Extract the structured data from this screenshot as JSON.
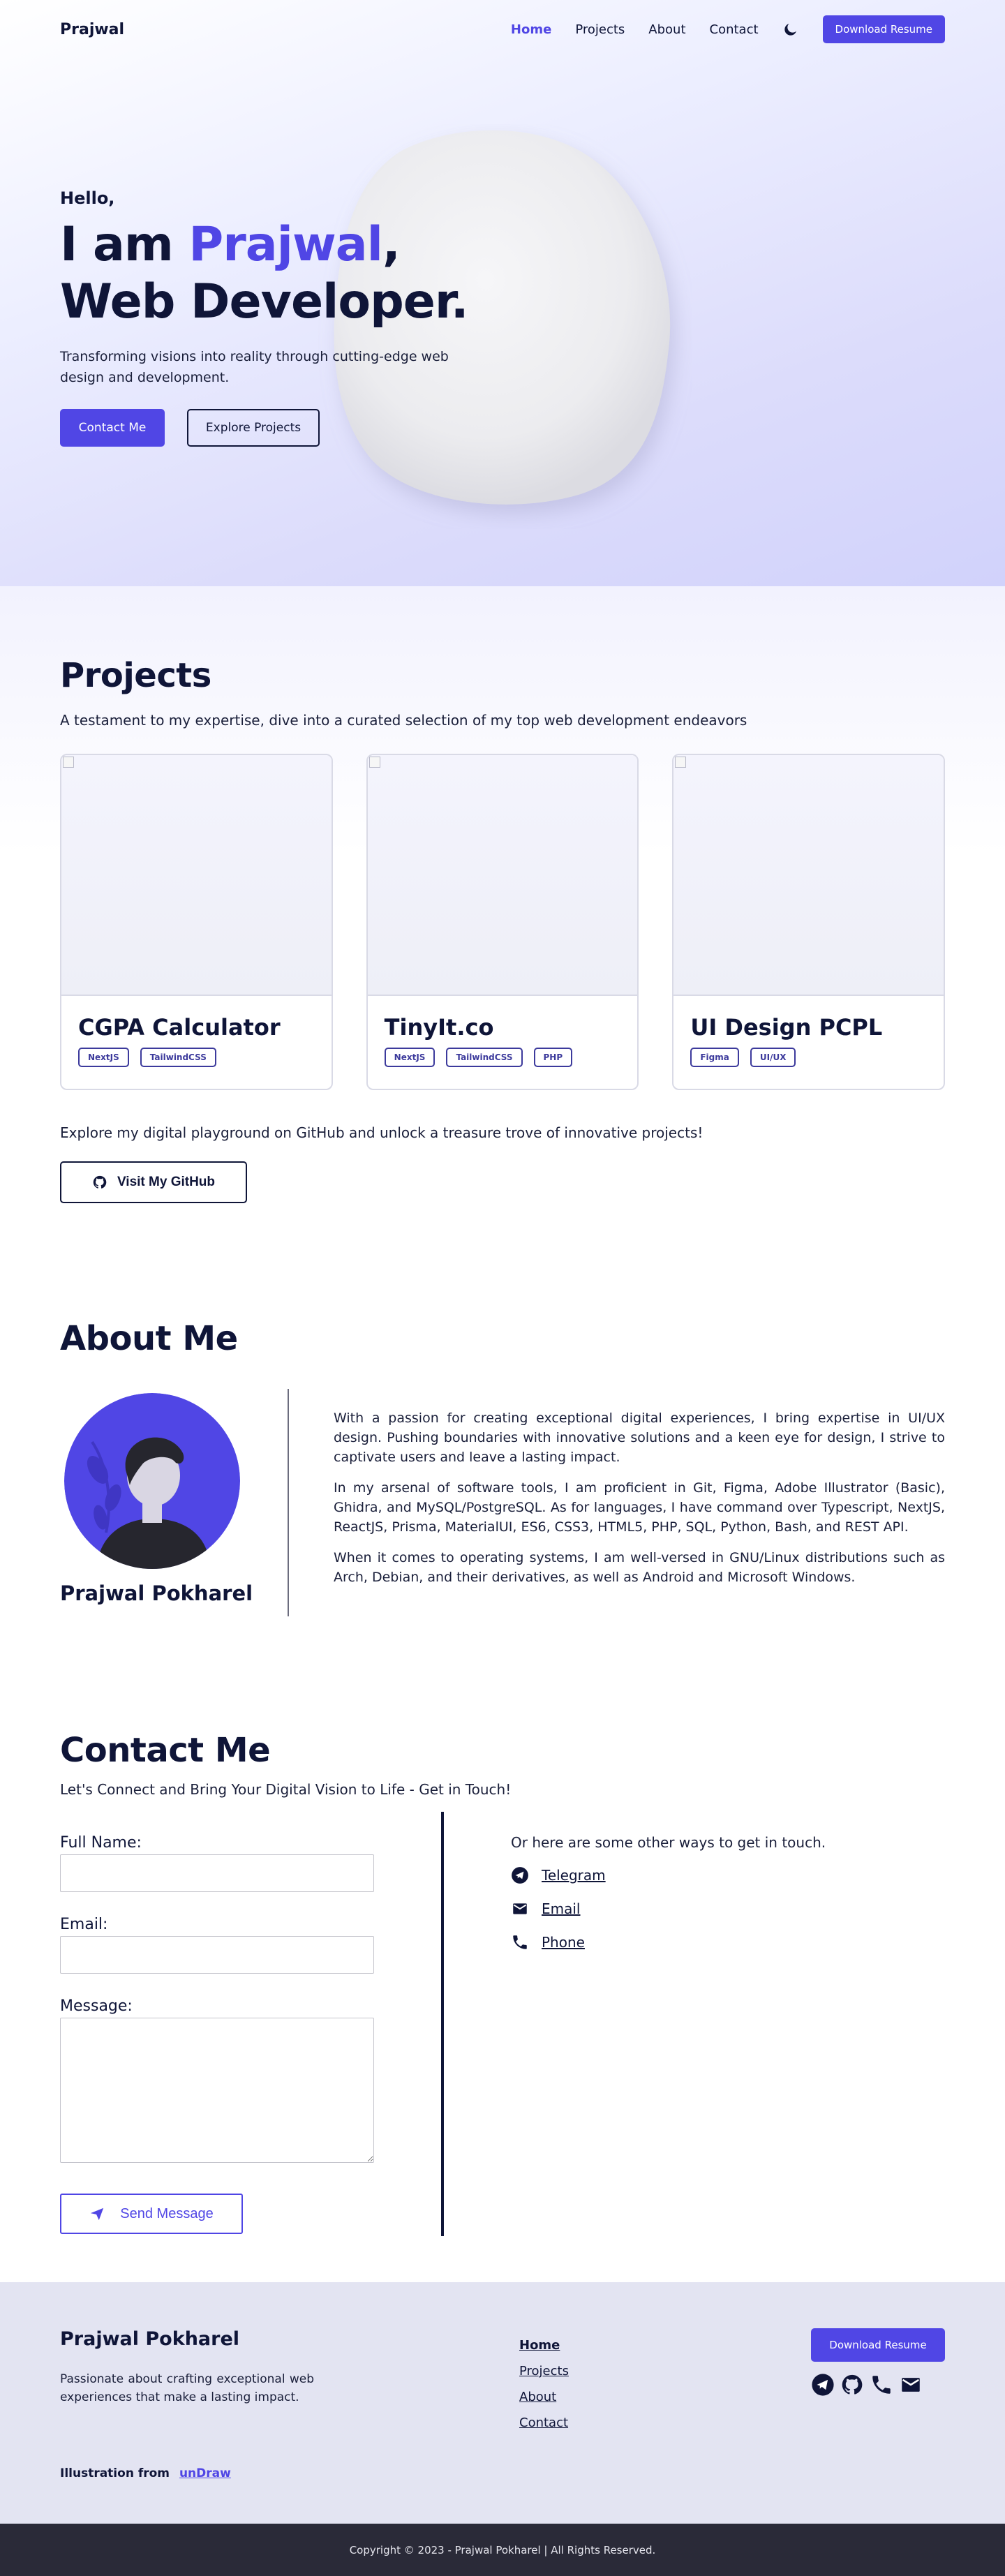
{
  "nav": {
    "brand": "Prajwal",
    "links": [
      "Home",
      "Projects",
      "About",
      "Contact"
    ],
    "resume_label": "Download Resume"
  },
  "hero": {
    "greeting": "Hello,",
    "title_prefix": "I am ",
    "title_name": "Prajwal",
    "title_comma": ",",
    "title_line2": "Web Developer.",
    "description": "Transforming visions into reality through cutting-edge web design and development.",
    "contact_label": "Contact Me",
    "explore_label": "Explore Projects"
  },
  "projects": {
    "title": "Projects",
    "subtitle": "A testament to my expertise, dive into a curated selection of my top web development endeavors",
    "cards": [
      {
        "title": "CGPA Calculator",
        "tags": [
          "NextJS",
          "TailwindCSS"
        ]
      },
      {
        "title": "TinyIt.co",
        "tags": [
          "NextJS",
          "TailwindCSS",
          "PHP"
        ]
      },
      {
        "title": "UI Design PCPL",
        "tags": [
          "Figma",
          "UI/UX"
        ]
      }
    ],
    "github_text": "Explore my digital playground on GitHub and unlock a treasure trove of innovative projects!",
    "github_label": "Visit My GitHub"
  },
  "about": {
    "title": "About Me",
    "name": "Prajwal Pokharel",
    "paragraphs": [
      "With a passion for creating exceptional digital experiences, I bring expertise in UI/UX design. Pushing boundaries with innovative solutions and a keen eye for design, I strive to captivate users and leave a lasting impact.",
      "In my arsenal of software tools, I am proficient in Git, Figma, Adobe Illustrator (Basic), Ghidra, and MySQL/PostgreSQL. As for languages, I have command over Typescript, NextJS, ReactJS, Prisma, MaterialUI, ES6, CSS3, HTML5, PHP, SQL, Python, Bash, and REST API.",
      "When it comes to operating systems, I am well-versed in GNU/Linux distributions such as Arch, Debian, and their derivatives, as well as Android and Microsoft Windows."
    ]
  },
  "contact": {
    "title": "Contact Me",
    "subtitle": "Let's Connect and Bring Your Digital Vision to Life - Get in Touch!",
    "name_label": "Full Name:",
    "email_label": "Email:",
    "message_label": "Message:",
    "send_label": "Send Message",
    "other_title": "Or here are some other ways to get in touch.",
    "other_links": [
      "Telegram",
      "Email",
      "Phone"
    ]
  },
  "footer": {
    "name": "Prajwal Pokharel",
    "description": "Passionate about crafting exceptional web experiences that make a lasting impact.",
    "illustration_prefix": "Illustration from",
    "illustration_link": "unDraw",
    "links": [
      "Home",
      "Projects",
      "About",
      "Contact"
    ],
    "resume_label": "Download Resume",
    "icons": [
      "telegram-icon",
      "github-icon",
      "phone-icon",
      "mail-icon"
    ],
    "copyright": "Copyright © 2023 - Prajwal Pokharel | All Rights Reserved."
  },
  "colors": {
    "accent": "#5046e5",
    "navy": "#0f1538",
    "footer_bg": "#e3e4f2",
    "copyright_bg": "#2a2a38"
  }
}
